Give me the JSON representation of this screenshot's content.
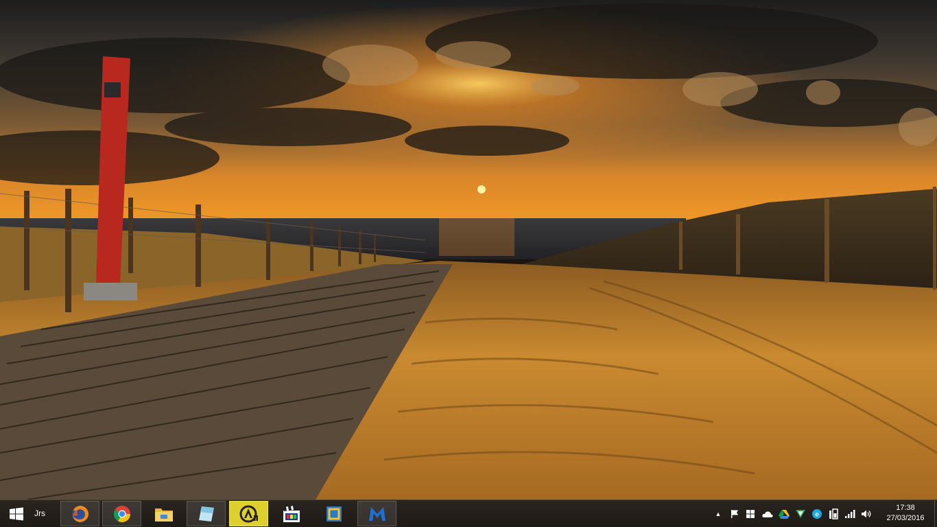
{
  "taskbar": {
    "toolbar_label": "Jrs",
    "start_icon": "windows-logo-icon",
    "pinned": [
      {
        "name": "firefox",
        "icon": "firefox-icon",
        "state": "running"
      },
      {
        "name": "chrome",
        "icon": "chrome-icon",
        "state": "running"
      },
      {
        "name": "file-explorer",
        "icon": "folder-icon",
        "state": "pinned"
      },
      {
        "name": "notes",
        "icon": "notes-icon",
        "state": "running"
      },
      {
        "name": "aimp",
        "icon": "aimp-icon",
        "state": "active"
      },
      {
        "name": "media-player-classic",
        "icon": "clapperboard-icon",
        "state": "pinned"
      },
      {
        "name": "app-blue-square",
        "icon": "blue-square-icon",
        "state": "pinned"
      },
      {
        "name": "malwarebytes",
        "icon": "malwarebytes-icon",
        "state": "running"
      }
    ],
    "tray_icons": [
      "show-hidden-icons-arrow",
      "flag-icon",
      "windows-icon",
      "onedrive-icon",
      "google-drive-icon",
      "vpn-shield-icon",
      "browser-e-icon",
      "battery-icon",
      "signal-icon",
      "volume-icon"
    ],
    "clock": {
      "time": "17:38",
      "date": "27/03/2016"
    },
    "colors": {
      "taskbar": "#221d19",
      "active_button": "#dccf2e"
    }
  }
}
